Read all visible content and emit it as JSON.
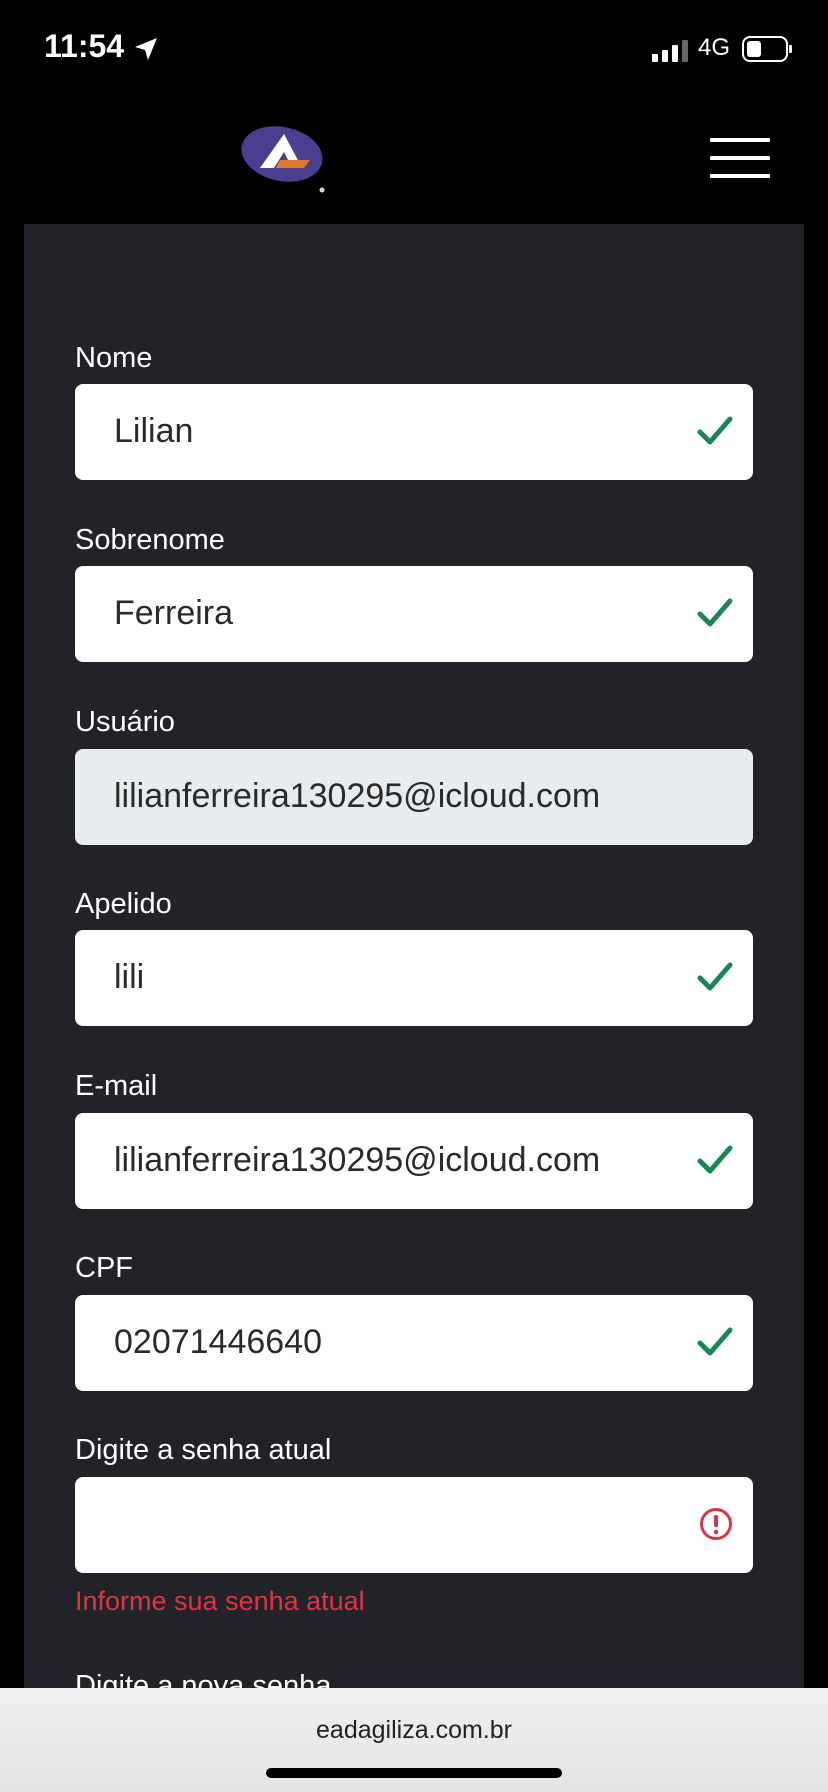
{
  "status": {
    "time": "11:54",
    "network": "4G"
  },
  "colors": {
    "panel": "#212328",
    "check": "#198754",
    "error": "#dc3545",
    "disabled": "#e8ecef"
  },
  "icons": {
    "location": "location-arrow-icon",
    "signal": "signal-icon",
    "battery": "battery-icon",
    "menu": "hamburger-menu-icon",
    "valid": "check-icon",
    "invalid": "exclamation-circle-icon"
  },
  "form": {
    "nome": {
      "label": "Nome",
      "value": "Lilian"
    },
    "sobrenome": {
      "label": "Sobrenome",
      "value": "Ferreira"
    },
    "usuario": {
      "label": "Usuário",
      "value": "lilianferreira130295@icloud.com"
    },
    "apelido": {
      "label": "Apelido",
      "value": "lili"
    },
    "email": {
      "label": "E-mail",
      "value": "lilianferreira130295@icloud.com"
    },
    "cpf": {
      "label": "CPF",
      "value": "02071446640"
    },
    "senha_atual": {
      "label": "Digite a senha atual",
      "value": "",
      "error": "Informe sua senha atual"
    },
    "nova_senha": {
      "label": "Digite a nova senha"
    }
  },
  "browser": {
    "url": "eadagiliza.com.br"
  }
}
